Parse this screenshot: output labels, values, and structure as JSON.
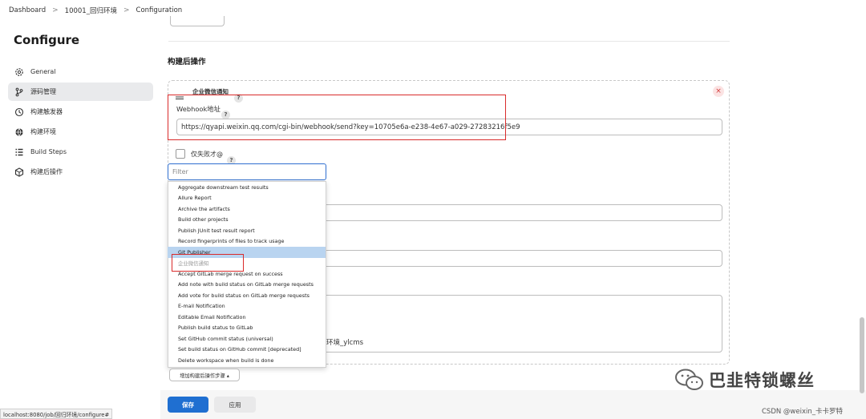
{
  "breadcrumb": [
    "Dashboard",
    "10001_回归环境",
    "Configuration"
  ],
  "page_title": "Configure",
  "sidebar": {
    "items": [
      {
        "label": "General",
        "icon": "gear-icon"
      },
      {
        "label": "源码管理",
        "icon": "branch-icon",
        "active": true
      },
      {
        "label": "构建触发器",
        "icon": "clock-icon"
      },
      {
        "label": "构建环境",
        "icon": "globe-icon"
      },
      {
        "label": "Build Steps",
        "icon": "list-icon"
      },
      {
        "label": "构建后操作",
        "icon": "cube-icon"
      }
    ]
  },
  "main": {
    "section_title": "构建后操作",
    "panel": {
      "title": "企业微信通知",
      "help": "?",
      "close": "×",
      "webhook_label": "Webhook地址",
      "webhook_value": "https://qyapi.weixin.qq.com/cgi-bin/webhook/send?key=10705e6a-e238-4e67-a029-27283216f5e9",
      "checkbox_label": "仅失败才@",
      "partial_text": "环境_ylcms"
    },
    "filter_placeholder": "Filter",
    "dropdown_items": [
      "Aggregate downstream test results",
      "Allure Report",
      "Archive the artifacts",
      "Build other projects",
      "Publish JUnit test result report",
      "Record fingerprints of files to track usage",
      "Git Publisher",
      "企业微信通知",
      "Accept GitLab merge request on success",
      "Add note with build status on GitLab merge requests",
      "Add vote for build status on GitLab merge requests",
      "E-mail Notification",
      "Editable Email Notification",
      "Publish build status to GitLab",
      "Set GitHub commit status (universal)",
      "Set build status on GitHub commit [deprecated]",
      "Delete workspace when build is done"
    ],
    "add_step_button": "增加构建后操作步骤 ▴",
    "save_button": "保存",
    "apply_button": "应用"
  },
  "status_url": "localhost:8080/job/回归环境/configure#",
  "watermark": "巴韭特锁螺丝",
  "csdn_credit": "CSDN @weixin_卡卡罗特",
  "colors": {
    "accent": "#1f6fd1",
    "highlight_red": "#d92b2b",
    "selected_row": "#b9d4f0"
  }
}
